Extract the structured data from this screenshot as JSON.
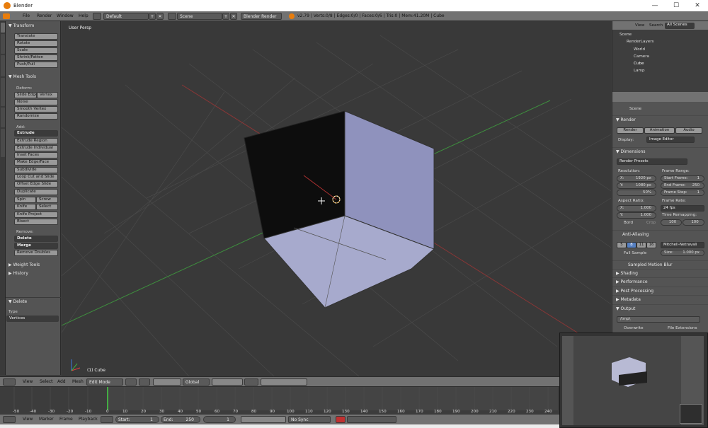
{
  "window": {
    "title": "Blender",
    "min": "—",
    "max": "☐",
    "close": "✕"
  },
  "menu": {
    "file": "File",
    "render": "Render",
    "window": "Window",
    "help": "Help",
    "layout": "Default",
    "scene": "Scene",
    "engine": "Blender Render",
    "stats": "v2.79 | Verts:0/8 | Edges:0/0 | Faces:0/6 | Tris:0 | Mem:41.20M | Cube"
  },
  "tabs": [
    "Tools",
    "Create",
    "Relations",
    "Shading / UVs",
    "Options",
    "Grease Pencil"
  ],
  "tools": {
    "transform_hdr": "▼ Transform",
    "transform": [
      "Translate",
      "Rotate",
      "Scale",
      "Shrink/Fatten",
      "Push/Pull"
    ],
    "meshtools_hdr": "▼ Mesh Tools",
    "deform_lbl": "Deform:",
    "slide_edge": "Slide Edge",
    "vertex": "Vertex",
    "deform": [
      "Noise",
      "Smooth Vertex",
      "Randomize"
    ],
    "add_lbl": "Add:",
    "extrude": "Extrude",
    "add": [
      "Extrude Region",
      "Extrude Individual",
      "Inset Faces",
      "Make Edge/Face",
      "Subdivide",
      "Loop Cut and Slide",
      "Offset Edge Slide",
      "Duplicate"
    ],
    "spin": "Spin",
    "screw": "Screw",
    "knife": "Knife",
    "select": "Select",
    "knife_project": "Knife Project",
    "bisect": "Bisect",
    "remove_lbl": "Remove:",
    "delete": "Delete",
    "merge": "Merge",
    "remove_doubles": "Remove Doubles",
    "weight_hdr": "▶ Weight Tools",
    "history_hdr": "▶ History",
    "delete_panel_hdr": "▼ Delete",
    "type_lbl": "Type",
    "type_val": "Vertices"
  },
  "viewport": {
    "label": "User Persp",
    "object": "(1) Cube"
  },
  "viewhdr": {
    "view": "View",
    "select": "Select",
    "add": "Add",
    "mesh": "Mesh",
    "mode": "Edit Mode",
    "orient": "Global"
  },
  "timeline": {
    "ticks": [
      "-50",
      "-40",
      "-30",
      "-20",
      "-10",
      "0",
      "10",
      "20",
      "30",
      "40",
      "50",
      "60",
      "70",
      "80",
      "90",
      "100",
      "110",
      "120",
      "130",
      "140",
      "150",
      "160",
      "170",
      "180",
      "190",
      "200",
      "210",
      "220",
      "230",
      "240",
      "250"
    ],
    "view": "View",
    "marker": "Marker",
    "frame": "Frame",
    "playback": "Playback",
    "start_lbl": "Start:",
    "start": "1",
    "end_lbl": "End:",
    "end": "250",
    "current": "1",
    "sync": "No Sync"
  },
  "outliner": {
    "view": "View",
    "search": "Search",
    "all": "All Scenes",
    "items": [
      "Scene",
      "RenderLayers",
      "World",
      "Camera",
      "Cube",
      "Lamp"
    ]
  },
  "props": {
    "scene": "Scene",
    "render_hdr": "▼ Render",
    "render": "Render",
    "animation": "Animation",
    "audio": "Audio",
    "display_lbl": "Display:",
    "display": "Image Editor",
    "dims_hdr": "▼ Dimensions",
    "presets": "Render Presets",
    "resolution": "Resolution:",
    "x_lbl": "X:",
    "x": "1920 px",
    "y_lbl": "Y:",
    "y": "1080 px",
    "pct": "50%",
    "frame_range": "Frame Range:",
    "start_frame": "Start Frame:",
    "start_v": "1",
    "end_frame": "End Frame:",
    "end_v": "250",
    "frame_step": "Frame Step:",
    "step_v": "1",
    "aspect": "Aspect Ratio:",
    "ax": "1.000",
    "ay": "1.000",
    "framerate": "Frame Rate:",
    "fps": "24 fps",
    "border": "Bord",
    "crop": "Crop",
    "remap": "Time Remapping:",
    "old": "100",
    "new": "100",
    "aa_hdr": "Anti-Aliasing",
    "aa": [
      "5",
      "8",
      "11",
      "16"
    ],
    "filter": "Mitchell-Netravali",
    "full_sample": "Full Sample",
    "size_lbl": "Size:",
    "size": "1.000 px",
    "mblur": "Sampled Motion Blur",
    "shading": "▶ Shading",
    "performance": "▶ Performance",
    "post": "▶ Post Processing",
    "metadata": "▶ Metadata",
    "output": "▼ Output",
    "path": "/tmp\\",
    "overwrite": "Overwrite",
    "file_ext": "File Extensions"
  },
  "colors": {
    "accent": "#5680c2",
    "orange": "#e87d0d",
    "cubefront": "#a7aacd"
  }
}
